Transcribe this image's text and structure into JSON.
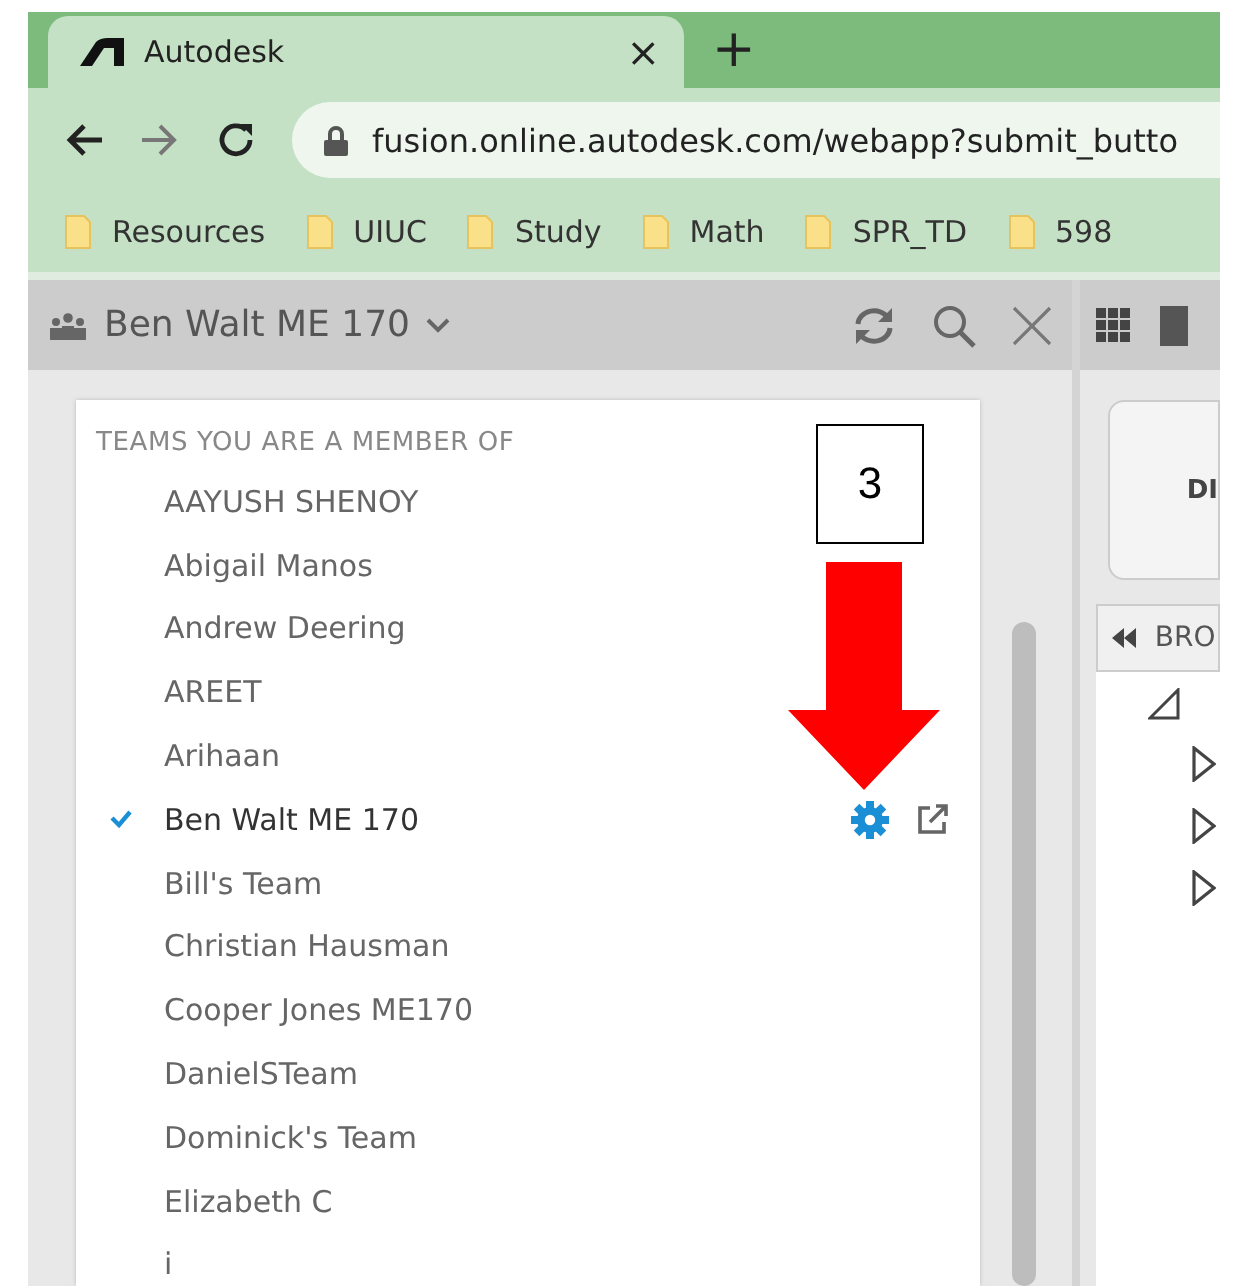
{
  "browser": {
    "tab": {
      "title": "Autodesk",
      "close": "×",
      "new_tab": "+"
    },
    "url": "fusion.online.autodesk.com/webapp?submit_butto",
    "bookmarks": [
      "Resources",
      "UIUC",
      "Study",
      "Math",
      "SPR_TD",
      "598"
    ]
  },
  "panel": {
    "team": "Ben Walt ME 170"
  },
  "dropdown": {
    "heading": "TEAMS YOU ARE A MEMBER OF",
    "teams": [
      {
        "name": "AAYUSH SHENOY",
        "selected": false
      },
      {
        "name": "Abigail Manos",
        "selected": false
      },
      {
        "name": "Andrew Deering",
        "selected": false
      },
      {
        "name": "AREET",
        "selected": false
      },
      {
        "name": "Arihaan",
        "selected": false
      },
      {
        "name": "Ben Walt ME 170",
        "selected": true
      },
      {
        "name": "Bill's Team",
        "selected": false
      },
      {
        "name": "Christian Hausman",
        "selected": false
      },
      {
        "name": "Cooper Jones ME170",
        "selected": false
      },
      {
        "name": "DanielSTeam",
        "selected": false
      },
      {
        "name": "Dominick's Team",
        "selected": false
      },
      {
        "name": "Elizabeth C",
        "selected": false
      },
      {
        "name": "i",
        "selected": false
      }
    ]
  },
  "annotation": {
    "step": "3"
  },
  "right_panel": {
    "button": "DI",
    "browser": "BRO"
  }
}
